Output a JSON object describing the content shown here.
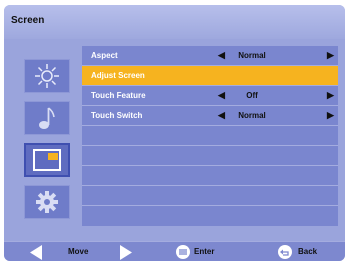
{
  "header": {
    "title": "Screen"
  },
  "sidebar": {
    "icons": [
      {
        "name": "brightness"
      },
      {
        "name": "music"
      },
      {
        "name": "screen"
      },
      {
        "name": "settings"
      }
    ]
  },
  "menu": {
    "rows": [
      {
        "label": "Aspect",
        "value": "Normal"
      },
      {
        "label": "Adjust Screen",
        "value": ""
      },
      {
        "label": "Touch Feature",
        "value": "Off"
      },
      {
        "label": "Touch Switch",
        "value": "Normal"
      }
    ],
    "empty_rows": 5
  },
  "footer": {
    "move_label": "Move",
    "enter_label": "Enter",
    "back_label": "Back"
  },
  "colors": {
    "accent": "#f6b31f",
    "row": "#7a86cf",
    "panel": "#9aa4dc"
  }
}
